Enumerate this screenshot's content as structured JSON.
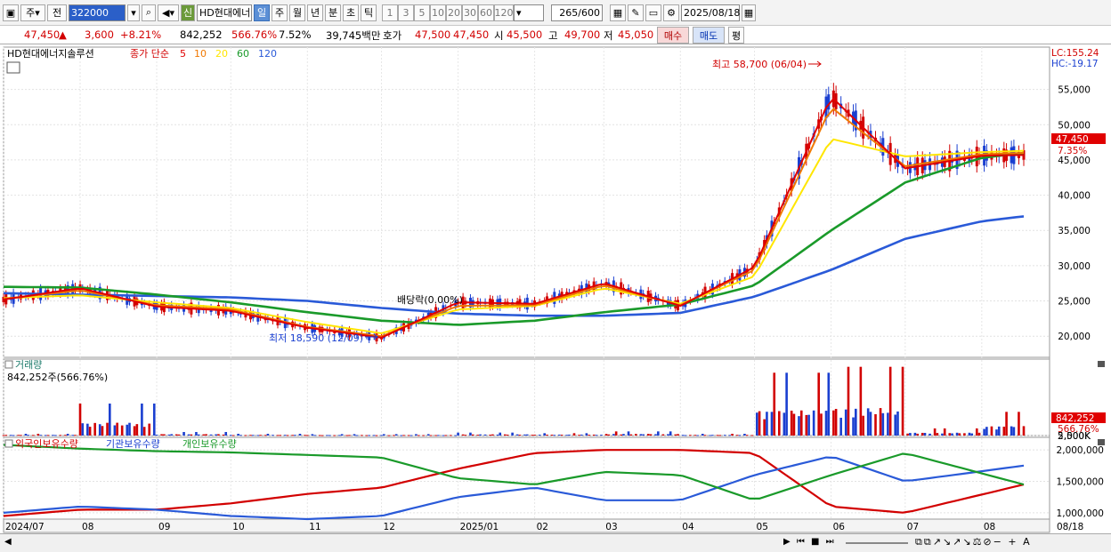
{
  "toolbar": {
    "period_label": "주",
    "all_label": "전",
    "code": "322000",
    "credit_badge": "신",
    "stock_name": "HD현대에너",
    "tabs": [
      "일",
      "주",
      "월",
      "년",
      "분",
      "초",
      "틱"
    ],
    "active_tab": "일",
    "num_buttons": [
      "1",
      "3",
      "5",
      "10",
      "20",
      "30",
      "60",
      "120"
    ],
    "count": "265",
    "count_total": "/600",
    "date": "2025/08/18"
  },
  "quote": {
    "price": "47,450",
    "change": "3,600",
    "change_pct": "+8.21%",
    "volume": "842,252",
    "vol_ratio": "566.76%",
    "turnover": "7.52%",
    "amount": "39,745백만",
    "hoga_label": "호가",
    "ask": "47,500",
    "bid": "47,450",
    "open_label": "시",
    "open": "45,500",
    "high_label": "고",
    "high": "49,700",
    "low_label": "저",
    "low": "45,050",
    "buy_label": "매수",
    "sell_label": "매도",
    "avg_label": "평"
  },
  "price_pane": {
    "stock_label": "HD현대에너지솔루션",
    "ma_label": "종가 단순",
    "ma_periods": [
      "5",
      "10",
      "20",
      "60",
      "120"
    ],
    "lc": "LC:155.24",
    "hc": "HC:-19.17",
    "max_note": "최고 58,700 (06/04)",
    "min_note": "최저 18,590 (12/09)",
    "div_note": "배당락(0.00%)",
    "last_price": "47,450",
    "last_pct": "7.35%",
    "y_ticks": [
      "55,000",
      "50,000",
      "45,000",
      "40,000",
      "35,000",
      "30,000",
      "25,000",
      "20,000"
    ]
  },
  "volume_pane": {
    "title": "거래량",
    "value_text": "842,252주(566.76%)",
    "y_ticks": [
      "5,000K",
      "2,500K"
    ],
    "last": "842,252",
    "last_pct": "566.76%"
  },
  "holding_pane": {
    "foreign_label": "외국인보유수량",
    "inst_label": "기관보유수량",
    "indiv_label": "개인보유수량",
    "y_ticks": [
      "2,000,000",
      "1,500,000",
      "1,000,000"
    ]
  },
  "x_axis": {
    "labels": [
      "2024/07",
      "08",
      "09",
      "10",
      "11",
      "12",
      "2025/01",
      "02",
      "03",
      "04",
      "05",
      "06",
      "07",
      "08"
    ],
    "right_label": "08/18"
  },
  "colors": {
    "up": "#d20000",
    "down": "#1a3fd0",
    "ma5": "#e00000",
    "ma10": "#f07800",
    "ma20": "#ffe600",
    "ma60": "#1a9a2a",
    "ma120": "#2a5ad8"
  },
  "chart_data": [
    {
      "type": "line",
      "title": "HD현대에너지솔루션 (일봉)",
      "ylim": [
        17000,
        61000
      ],
      "x": [
        "2024-07-01",
        "2024-08-01",
        "2024-09-01",
        "2024-10-01",
        "2024-11-01",
        "2024-12-01",
        "2025-01-01",
        "2025-02-01",
        "2025-03-01",
        "2025-04-01",
        "2025-05-01",
        "2025-06-01",
        "2025-07-01",
        "2025-08-01",
        "2025-08-18"
      ],
      "series": [
        {
          "name": "5",
          "values": [
            25200,
            26800,
            24200,
            23600,
            21200,
            19800,
            24800,
            24600,
            27500,
            24300,
            29800,
            54000,
            43800,
            45600,
            45700
          ]
        },
        {
          "name": "10",
          "values": [
            25300,
            26500,
            24400,
            23800,
            21300,
            20000,
            24300,
            24400,
            27200,
            24400,
            29400,
            52500,
            44100,
            45800,
            46000
          ]
        },
        {
          "name": "20",
          "values": [
            25400,
            25800,
            24800,
            24000,
            22000,
            20400,
            23800,
            24300,
            26800,
            24600,
            28500,
            48000,
            45500,
            46100,
            46300
          ]
        },
        {
          "name": "60",
          "values": [
            27000,
            26900,
            25900,
            24800,
            23400,
            22200,
            21600,
            22200,
            23400,
            24500,
            27200,
            35000,
            41800,
            45300,
            46000
          ]
        },
        {
          "name": "120",
          "values": [
            26100,
            25900,
            25700,
            25500,
            25000,
            24000,
            23200,
            22900,
            22900,
            23300,
            25600,
            29400,
            33800,
            36300,
            37000
          ]
        }
      ]
    },
    {
      "type": "bar",
      "title": "거래량",
      "ylim": [
        0,
        6300000
      ],
      "categories": [
        "2024-07",
        "2024-08",
        "2024-09",
        "2024-10",
        "2024-11",
        "2024-12",
        "2025-01",
        "2025-02",
        "2025-03",
        "2025-04",
        "2025-05",
        "2025-06",
        "2025-07",
        "2025-08"
      ],
      "values": [
        150000,
        2700000,
        300000,
        150000,
        120000,
        120000,
        250000,
        200000,
        350000,
        150000,
        5300000,
        5800000,
        600000,
        2000000
      ]
    },
    {
      "type": "line",
      "title": "보유수량",
      "ylim": [
        900000,
        2200000
      ],
      "x": [
        "2024-07",
        "2024-08",
        "2024-09",
        "2024-10",
        "2024-11",
        "2024-12",
        "2025-01",
        "2025-02",
        "2025-03",
        "2025-04",
        "2025-05",
        "2025-06",
        "2025-07",
        "2025-08"
      ],
      "series": [
        {
          "name": "외국인보유수량",
          "values": [
            950000,
            1050000,
            1050000,
            1150000,
            1300000,
            1400000,
            1700000,
            1950000,
            2000000,
            2000000,
            1950000,
            1100000,
            1000000,
            1450000
          ]
        },
        {
          "name": "기관보유수량",
          "values": [
            1000000,
            1100000,
            1050000,
            950000,
            900000,
            950000,
            1250000,
            1400000,
            1200000,
            1200000,
            1600000,
            1900000,
            1500000,
            1750000
          ]
        },
        {
          "name": "개인보유수량",
          "values": [
            2080000,
            2020000,
            1980000,
            1960000,
            1920000,
            1880000,
            1550000,
            1450000,
            1650000,
            1600000,
            1200000,
            1600000,
            1950000,
            1450000
          ]
        }
      ]
    }
  ]
}
